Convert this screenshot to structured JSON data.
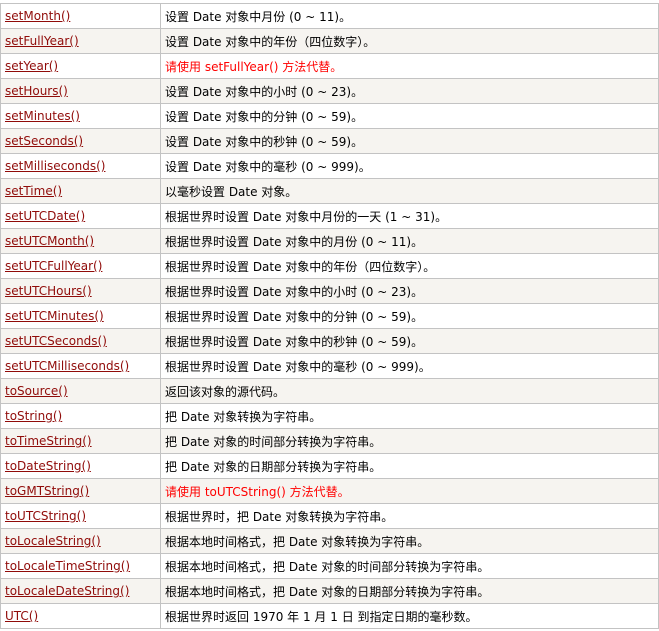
{
  "colors": {
    "link": "#900b09",
    "deprecated": "#ff0000",
    "border": "#c3c3c3",
    "row_alt": "#f6f4f0"
  },
  "rows": [
    {
      "method": "setMonth()",
      "desc": "设置 Date 对象中月份 (0 ~ 11)。",
      "deprecated": false
    },
    {
      "method": "setFullYear()",
      "desc": "设置 Date 对象中的年份（四位数字）。",
      "deprecated": false
    },
    {
      "method": "setYear()",
      "desc": "请使用 setFullYear() 方法代替。",
      "deprecated": true
    },
    {
      "method": "setHours()",
      "desc": "设置 Date 对象中的小时 (0 ~ 23)。",
      "deprecated": false
    },
    {
      "method": "setMinutes()",
      "desc": "设置 Date 对象中的分钟 (0 ~ 59)。",
      "deprecated": false
    },
    {
      "method": "setSeconds()",
      "desc": "设置 Date 对象中的秒钟 (0 ~ 59)。",
      "deprecated": false
    },
    {
      "method": "setMilliseconds()",
      "desc": "设置 Date 对象中的毫秒 (0 ~ 999)。",
      "deprecated": false
    },
    {
      "method": "setTime()",
      "desc": "以毫秒设置 Date 对象。",
      "deprecated": false
    },
    {
      "method": "setUTCDate()",
      "desc": "根据世界时设置 Date 对象中月份的一天 (1 ~ 31)。",
      "deprecated": false
    },
    {
      "method": "setUTCMonth()",
      "desc": "根据世界时设置 Date 对象中的月份 (0 ~ 11)。",
      "deprecated": false
    },
    {
      "method": "setUTCFullYear()",
      "desc": "根据世界时设置 Date 对象中的年份（四位数字）。",
      "deprecated": false
    },
    {
      "method": "setUTCHours()",
      "desc": "根据世界时设置 Date 对象中的小时 (0 ~ 23)。",
      "deprecated": false
    },
    {
      "method": "setUTCMinutes()",
      "desc": "根据世界时设置 Date 对象中的分钟 (0 ~ 59)。",
      "deprecated": false
    },
    {
      "method": "setUTCSeconds()",
      "desc": "根据世界时设置 Date 对象中的秒钟 (0 ~ 59)。",
      "deprecated": false
    },
    {
      "method": "setUTCMilliseconds()",
      "desc": "根据世界时设置 Date 对象中的毫秒 (0 ~ 999)。",
      "deprecated": false
    },
    {
      "method": "toSource()",
      "desc": "返回该对象的源代码。",
      "deprecated": false
    },
    {
      "method": "toString()",
      "desc": "把 Date 对象转换为字符串。",
      "deprecated": false
    },
    {
      "method": "toTimeString()",
      "desc": "把 Date 对象的时间部分转换为字符串。",
      "deprecated": false
    },
    {
      "method": "toDateString()",
      "desc": "把 Date 对象的日期部分转换为字符串。",
      "deprecated": false
    },
    {
      "method": "toGMTString()",
      "desc": "请使用 toUTCString() 方法代替。",
      "deprecated": true
    },
    {
      "method": "toUTCString()",
      "desc": "根据世界时，把 Date 对象转换为字符串。",
      "deprecated": false
    },
    {
      "method": "toLocaleString()",
      "desc": "根据本地时间格式，把 Date 对象转换为字符串。",
      "deprecated": false
    },
    {
      "method": "toLocaleTimeString()",
      "desc": "根据本地时间格式，把 Date 对象的时间部分转换为字符串。",
      "deprecated": false
    },
    {
      "method": "toLocaleDateString()",
      "desc": "根据本地时间格式，把 Date 对象的日期部分转换为字符串。",
      "deprecated": false
    },
    {
      "method": "UTC()",
      "desc": "根据世界时返回 1970 年 1 月 1 日 到指定日期的毫秒数。",
      "deprecated": false
    }
  ]
}
